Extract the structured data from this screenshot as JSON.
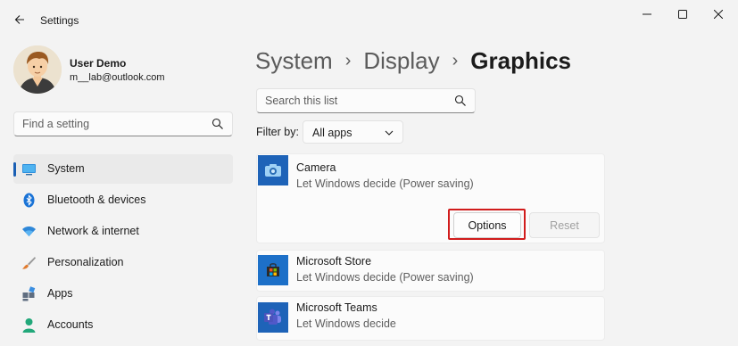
{
  "window": {
    "title": "Settings"
  },
  "user": {
    "name": "User Demo",
    "email": "m__lab@outlook.com"
  },
  "sidebar": {
    "search_placeholder": "Find a setting",
    "items": [
      {
        "label": "System",
        "icon": "system-icon",
        "active": true
      },
      {
        "label": "Bluetooth & devices",
        "icon": "bluetooth-icon"
      },
      {
        "label": "Network & internet",
        "icon": "wifi-icon"
      },
      {
        "label": "Personalization",
        "icon": "brush-icon"
      },
      {
        "label": "Apps",
        "icon": "apps-icon"
      },
      {
        "label": "Accounts",
        "icon": "accounts-icon"
      }
    ]
  },
  "breadcrumb": {
    "items": [
      "System",
      "Display",
      "Graphics"
    ]
  },
  "main": {
    "search_placeholder": "Search this list",
    "filter": {
      "label": "Filter by:",
      "value": "All apps"
    },
    "apps": [
      {
        "name": "Camera",
        "preference": "Let Windows decide (Power saving)",
        "icon": "camera-icon",
        "expanded": true,
        "options_label": "Options",
        "reset_label": "Reset"
      },
      {
        "name": "Microsoft Store",
        "preference": "Let Windows decide (Power saving)",
        "icon": "store-icon"
      },
      {
        "name": "Microsoft Teams",
        "preference": "Let Windows decide",
        "icon": "teams-icon"
      }
    ]
  },
  "colors": {
    "accent": "#1a5fb4",
    "highlight": "#d11c1c"
  }
}
